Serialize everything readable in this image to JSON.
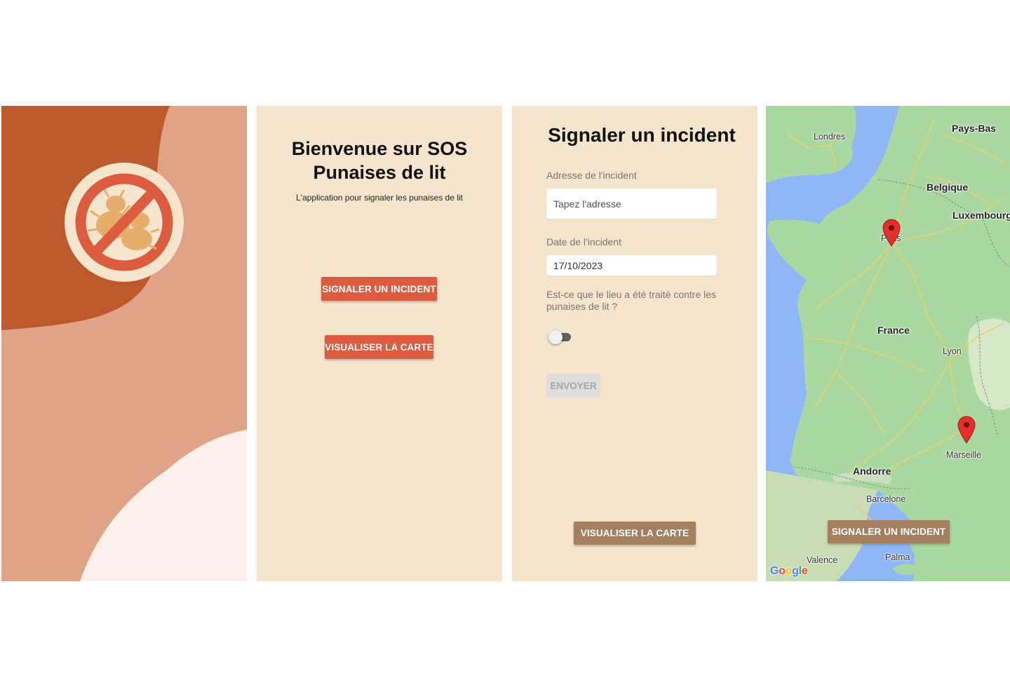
{
  "colors": {
    "splash_dark": "#bd5a2b",
    "splash_mid": "#e0a385",
    "splash_light": "#fbf0ea",
    "beige": "#f6e5cd",
    "accent_red": "#dd5b3e",
    "accent_brown": "#a5805f",
    "map_sea": "#8fb7f5",
    "map_land": "#a9d8a0",
    "pin_red": "#e2302a"
  },
  "splash": {
    "logo_icon": "no-bedbugs-icon"
  },
  "welcome": {
    "title": "Bienvenue sur SOS Punaises de lit",
    "subtitle": "L'application pour signaler les punaises de lit",
    "report_button": "SIGNALER UN INCIDENT",
    "map_button": "VISUALISER LA CARTE"
  },
  "report": {
    "title": "Signaler un incident",
    "address_label": "Adresse de l'incident",
    "address_placeholder": "Tapez l'adresse",
    "address_value": "",
    "date_label": "Date de l'incident",
    "date_value": "17/10/2023",
    "treated_question": "Est-ce que le lieu a été traité contre les punaises de lit ?",
    "treated": false,
    "submit_button": "ENVOYER",
    "map_button": "VISUALISER LA CARTE"
  },
  "map": {
    "country_labels": [
      "Pays-Bas",
      "Belgique",
      "Luxembourg",
      "France",
      "Andorre"
    ],
    "city_labels": [
      "Londres",
      "Paris",
      "Lyon",
      "Marseille",
      "Barcelone",
      "Valence",
      "Palma"
    ],
    "report_button": "SIGNALER UN INCIDENT",
    "attribution": "Google",
    "markers": [
      "Paris",
      "Marseille"
    ]
  }
}
